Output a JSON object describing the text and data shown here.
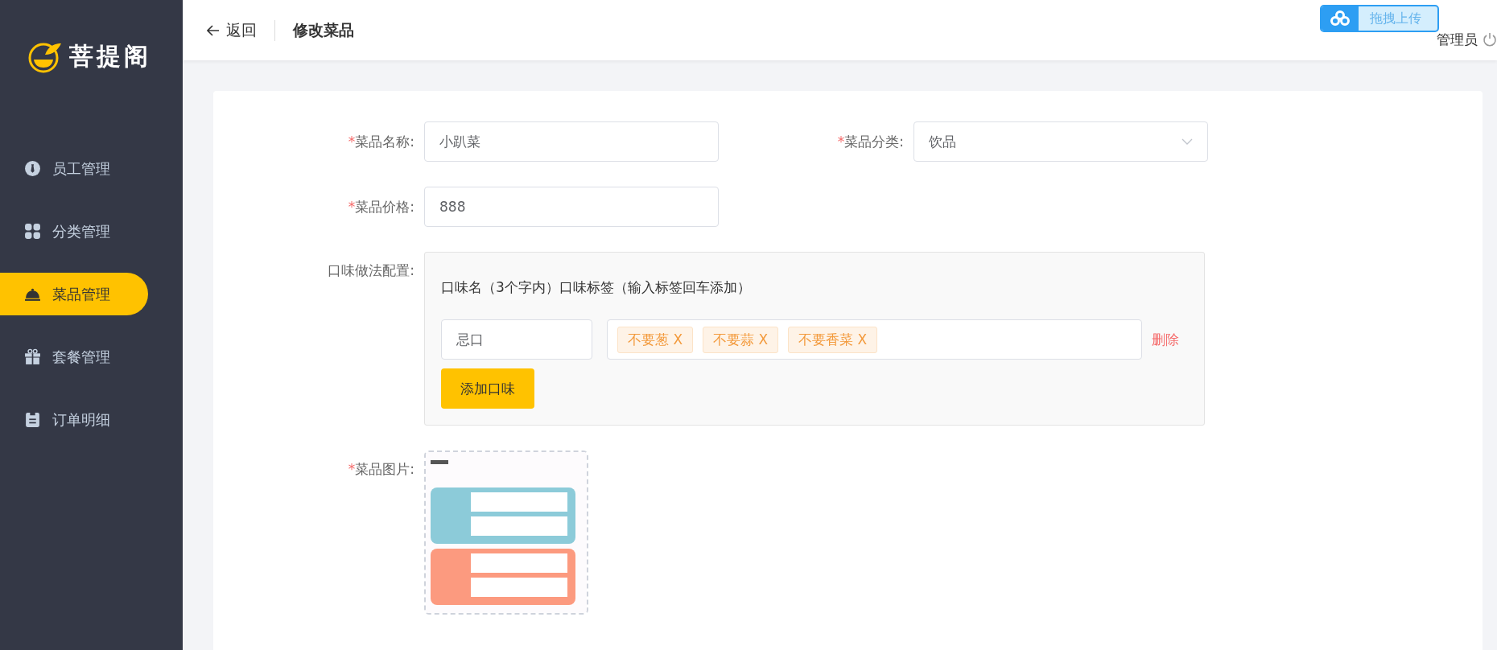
{
  "sidebar": {
    "logo": "菩提阁",
    "items": [
      {
        "label": "员工管理",
        "selected": false
      },
      {
        "label": "分类管理",
        "selected": false
      },
      {
        "label": "菜品管理",
        "selected": true
      },
      {
        "label": "套餐管理",
        "selected": false
      },
      {
        "label": "订单明细",
        "selected": false
      }
    ]
  },
  "header": {
    "back": "返回",
    "title": "修改菜品",
    "user": "管理员",
    "upload_widget": "拖拽上传"
  },
  "form": {
    "name": {
      "label": "菜品名称:",
      "required_mark": "*",
      "value": "小趴菜"
    },
    "category": {
      "label": "菜品分类:",
      "required_mark": "*",
      "value": "饮品"
    },
    "price": {
      "label": "菜品价格:",
      "required_mark": "*",
      "value": "888"
    },
    "flavors": {
      "label": "口味做法配置:",
      "hint": "口味名（3个字内）口味标签（输入标签回车添加）",
      "rows": [
        {
          "name": "忌口",
          "tags": [
            "不要葱 X",
            "不要蒜 X",
            "不要香菜 X"
          ],
          "delete": "删除"
        }
      ],
      "add_button": "添加口味"
    },
    "image": {
      "label": "菜品图片:",
      "required_mark": "*",
      "kind": "picture"
    }
  }
}
